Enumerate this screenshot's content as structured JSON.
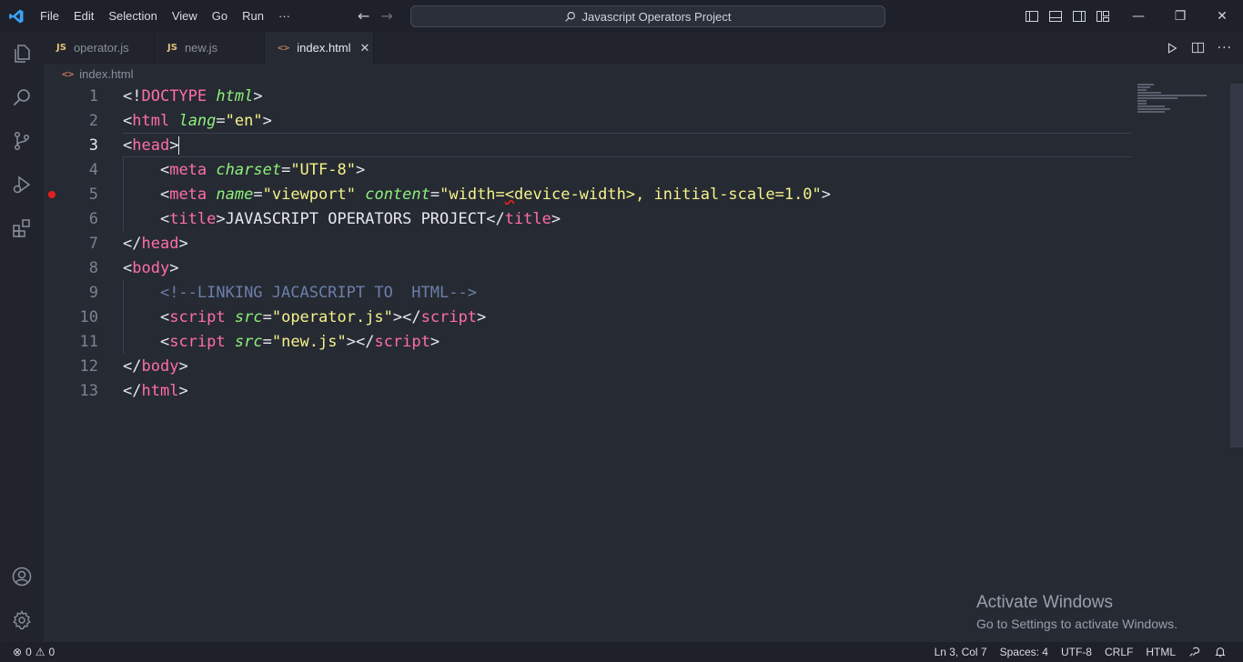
{
  "titlebar": {
    "menu": [
      "File",
      "Edit",
      "Selection",
      "View",
      "Go",
      "Run",
      "···"
    ],
    "search_text": "Javascript Operators Project"
  },
  "tabs": [
    {
      "icon": "JS",
      "label": "operator.js",
      "active": false
    },
    {
      "icon": "JS",
      "label": "new.js",
      "active": false
    },
    {
      "icon": "<>",
      "label": "index.html",
      "active": true,
      "close": "✕"
    }
  ],
  "breadcrumb": {
    "icon": "<>",
    "label": "index.html"
  },
  "editor": {
    "line_numbers": [
      "1",
      "2",
      "3",
      "4",
      "5",
      "6",
      "7",
      "8",
      "9",
      "10",
      "11",
      "12",
      "13"
    ],
    "current_line": "3"
  },
  "watermark": {
    "title": "Activate Windows",
    "subtitle": "Go to Settings to activate Windows."
  },
  "statusbar": {
    "errors": "0",
    "warnings": "0",
    "position": "Ln 3, Col 7",
    "spaces": "Spaces: 4",
    "encoding": "UTF-8",
    "eol": "CRLF",
    "language": "HTML"
  },
  "colors": {
    "tag": "#ff6fa3",
    "attribute": "#8ef07b",
    "string": "#f5f28a",
    "comment": "#6b7fa8",
    "breakpoint": "#e51f1f"
  }
}
